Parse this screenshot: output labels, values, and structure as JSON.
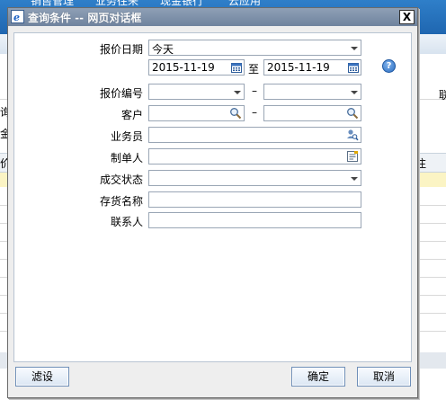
{
  "background": {
    "menu": [
      "销售管理",
      "业务往来",
      "现金银行",
      "云应用"
    ],
    "left_fragments": [
      "询",
      "金",
      "价"
    ],
    "right_fragments": [
      "联",
      "注"
    ]
  },
  "dialog": {
    "title": "查询条件  --  网页对话框",
    "close_label": "X",
    "help_label": "?",
    "fields": {
      "quote_date_label": "报价日期",
      "quote_date_preset": "今天",
      "date_from": "2015-11-19",
      "to_label": "至",
      "date_to": "2015-11-19",
      "quote_no_label": "报价编号",
      "quote_no_from": "",
      "quote_no_to": "",
      "dash": "–",
      "customer_label": "客户",
      "customer_from": "",
      "customer_to": "",
      "salesperson_label": "业务员",
      "salesperson_value": "",
      "creator_label": "制单人",
      "creator_value": "",
      "deal_status_label": "成交状态",
      "deal_status_value": "",
      "inventory_name_label": "存货名称",
      "inventory_name_value": "",
      "contact_label": "联系人",
      "contact_value": ""
    },
    "buttons": {
      "filter": "滤设",
      "ok": "确定",
      "cancel": "取消"
    }
  }
}
